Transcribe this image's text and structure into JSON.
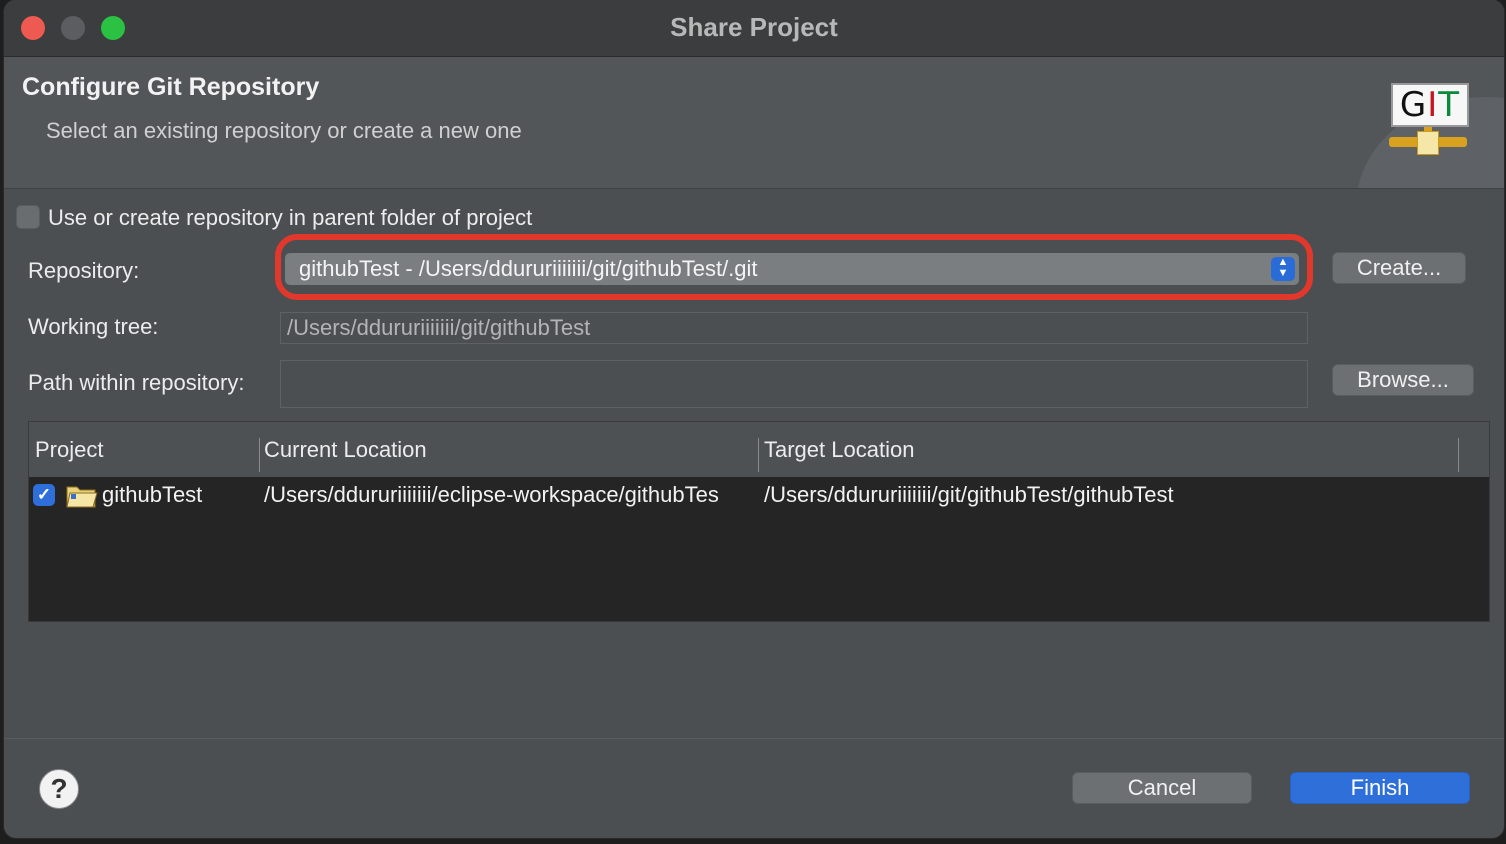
{
  "window": {
    "title": "Share Project",
    "traffic_lights": [
      "close",
      "minimize",
      "maximize"
    ]
  },
  "banner": {
    "title": "Configure Git Repository",
    "subtitle": "Select an existing repository or create a new one",
    "logo_icon": "git-logo-icon",
    "logo_text": "GIT"
  },
  "form": {
    "parent_folder_checkbox": {
      "label": "Use or create repository in parent folder of project",
      "checked": false
    },
    "repository": {
      "label": "Repository:",
      "value": "githubTest - /Users/ddururiiiiiii/git/githubTest/.git"
    },
    "create_button": "Create...",
    "working_tree": {
      "label": "Working tree:",
      "value": "/Users/ddururiiiiiii/git/githubTest"
    },
    "path_within": {
      "label": "Path within repository:",
      "value": ""
    },
    "browse_button": "Browse..."
  },
  "table": {
    "columns": [
      "Project",
      "Current Location",
      "Target Location"
    ],
    "rows": [
      {
        "checked": true,
        "project": "githubTest",
        "current_location": "/Users/ddururiiiiiii/eclipse-workspace/githubTes",
        "target_location": "/Users/ddururiiiiiii/git/githubTest/githubTest"
      }
    ]
  },
  "footer": {
    "help_icon": "help-icon",
    "cancel_button": "Cancel",
    "finish_button": "Finish"
  },
  "colors": {
    "accent": "#2e6fd9",
    "highlight": "#e2382c"
  }
}
